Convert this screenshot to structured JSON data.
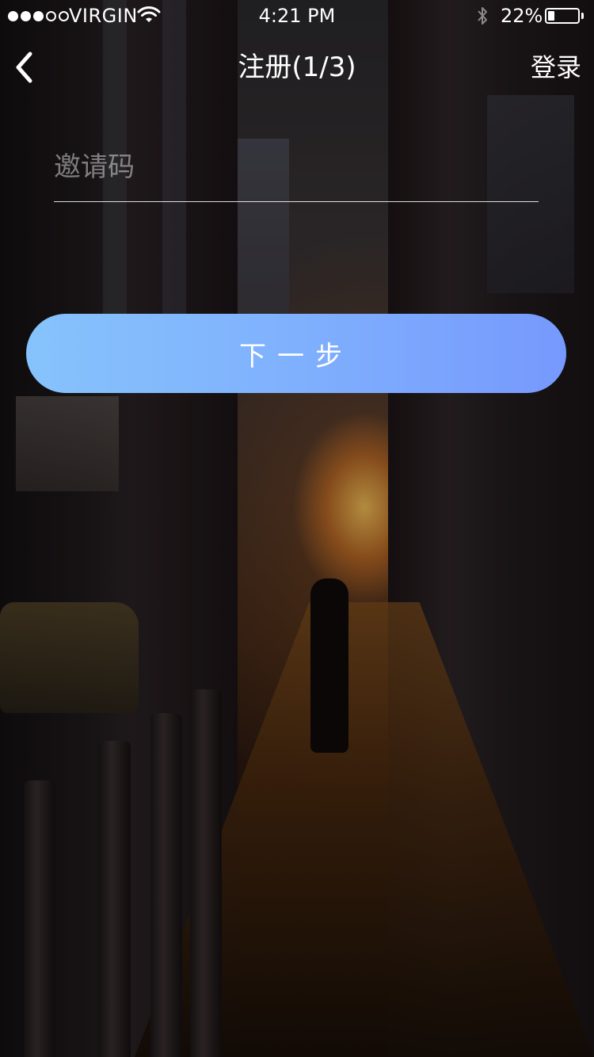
{
  "status_bar": {
    "signal_bars": [
      true,
      true,
      true,
      false,
      false
    ],
    "carrier": "VIRGIN",
    "time": "4:21 PM",
    "battery_percent_label": "22%",
    "battery_level": 0.22
  },
  "nav": {
    "back_icon": "chevron-left-icon",
    "title": "注册(1/3)",
    "login_label": "登录"
  },
  "form": {
    "invite_code": {
      "placeholder": "邀请码",
      "value": ""
    },
    "next_label": "下一步"
  },
  "colors": {
    "button_gradient_start": "#86c3fc",
    "button_gradient_end": "#7699fd",
    "text": "#ffffff"
  }
}
